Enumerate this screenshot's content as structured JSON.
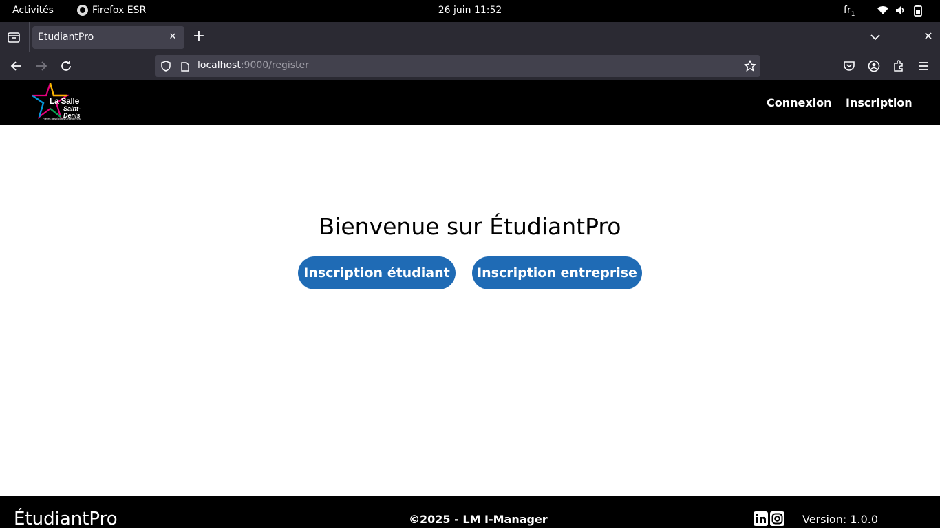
{
  "os_bar": {
    "activities": "Activités",
    "app_name": "Firefox ESR",
    "clock": "26 juin  11:52",
    "keyboard_layout": "fr",
    "keyboard_sub": "1",
    "tray_icons": [
      "wifi-icon",
      "volume-icon",
      "battery-icon"
    ]
  },
  "browser": {
    "tab_title": "EtudiantPro",
    "url_host": "localhost",
    "url_rest": ":9000/register"
  },
  "site": {
    "logo": {
      "line1": "La Salle",
      "line2": "Saint-Denis",
      "line3": "Frères des Écoles Chrétiennes"
    },
    "nav": {
      "login": "Connexion",
      "register": "Inscription"
    }
  },
  "main": {
    "heading": "Bienvenue sur ÉtudiantPro",
    "student_button": "Inscription étudiant",
    "company_button": "Inscription entreprise"
  },
  "footer": {
    "brand": "ÉtudiantPro",
    "copyright": "©2025 - LM I-Manager",
    "social_icons": [
      "linkedin-icon",
      "instagram-icon"
    ],
    "version": "Version: 1.0.0"
  },
  "colors": {
    "primary_button": "#1f6bb5",
    "header_bg": "#000000",
    "browser_chrome": "#2b2a33"
  }
}
